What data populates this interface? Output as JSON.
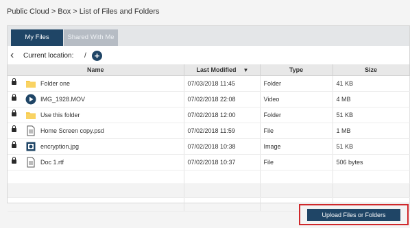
{
  "breadcrumb": "Public Cloud > Box > List of Files and Folders",
  "tabs": {
    "my_files": "My Files",
    "shared_with_me": "Shared With Me"
  },
  "location": {
    "label": "Current location:",
    "path": "/"
  },
  "columns": {
    "name": "Name",
    "modified": "Last Modified",
    "type": "Type",
    "size": "Size"
  },
  "files": [
    {
      "name": "Folder one",
      "modified": "07/03/2018 11:45",
      "type": "Folder",
      "size": "41 KB",
      "icon": "folder-icon"
    },
    {
      "name": "IMG_1928.MOV",
      "modified": "07/02/2018 22:08",
      "type": "Video",
      "size": "4 MB",
      "icon": "video-icon"
    },
    {
      "name": "Use this folder",
      "modified": "07/02/2018 12:00",
      "type": "Folder",
      "size": "51 KB",
      "icon": "folder-icon"
    },
    {
      "name": "Home Screen copy.psd",
      "modified": "07/02/2018 11:59",
      "type": "File",
      "size": "1 MB",
      "icon": "document-icon"
    },
    {
      "name": "encryption.jpg",
      "modified": "07/02/2018 10:38",
      "type": "Image",
      "size": "51 KB",
      "icon": "image-icon"
    },
    {
      "name": "Doc 1.rtf",
      "modified": "07/02/2018 10:37",
      "type": "File",
      "size": "506 bytes",
      "icon": "document-icon"
    }
  ],
  "upload_label": "Upload Files or Folders",
  "colors": {
    "navy": "#1f4566",
    "folder": "#f7c948",
    "highlight": "#d0282b"
  }
}
